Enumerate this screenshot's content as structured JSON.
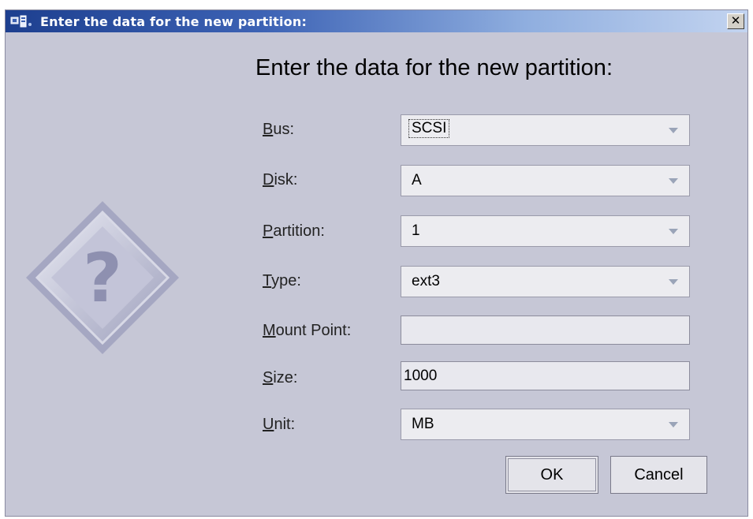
{
  "window": {
    "title": "Enter the data for the new partition:",
    "close_glyph": "✕",
    "icon": "network-computer-icon"
  },
  "heading": "Enter the data for the new partition:",
  "illustration": {
    "icon": "question-diamond-icon",
    "glyph": "?"
  },
  "fields": {
    "bus": {
      "label_first": "B",
      "label_rest": "us:",
      "value": "SCSI"
    },
    "disk": {
      "label_first": "D",
      "label_rest": "isk:",
      "value": "A"
    },
    "partition": {
      "label_first": "P",
      "label_rest": "artition:",
      "value": "1"
    },
    "type": {
      "label_first": "T",
      "label_rest": "ype:",
      "value": "ext3"
    },
    "mount_point": {
      "label_first": "M",
      "label_rest": "ount Point:",
      "value": ""
    },
    "size": {
      "label_first": "S",
      "label_rest": "ize:",
      "value": "1000"
    },
    "unit": {
      "label_first": "U",
      "label_rest": "nit:",
      "value": "MB"
    }
  },
  "buttons": {
    "ok": "OK",
    "cancel": "Cancel"
  },
  "colors": {
    "dialog_bg": "#c6c7d6",
    "titlebar_start": "#1d3f8f",
    "titlebar_end": "#c3d4f0"
  }
}
